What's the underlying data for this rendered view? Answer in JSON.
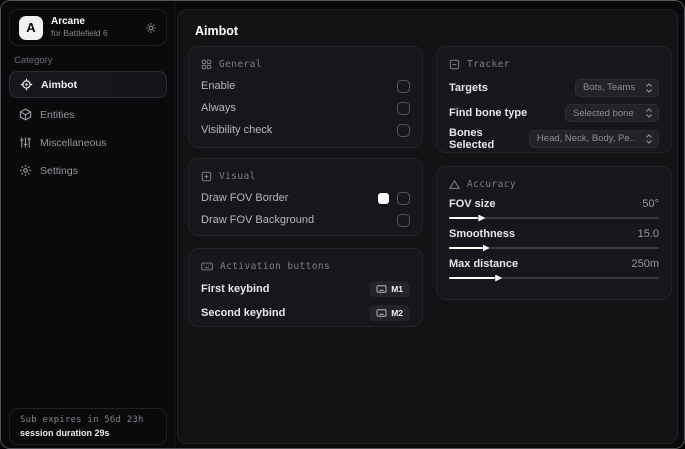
{
  "app": {
    "name": "Arcane",
    "subtitle": "for Battlefield 6",
    "logo_letter": "A"
  },
  "sidebar": {
    "category_label": "Category",
    "items": [
      {
        "label": "Aimbot",
        "icon": "crosshair-icon",
        "active": true
      },
      {
        "label": "Entities",
        "icon": "cube-icon",
        "active": false
      },
      {
        "label": "Miscellaneous",
        "icon": "sliders-icon",
        "active": false
      },
      {
        "label": "Settings",
        "icon": "gear-icon",
        "active": false
      }
    ],
    "subscription": {
      "expires_text": "Sub expires in 56d 23h",
      "session_text": "session duration 29s"
    }
  },
  "main": {
    "title": "Aimbot",
    "general": {
      "title": "General",
      "rows": [
        {
          "label": "Enable",
          "checked": false
        },
        {
          "label": "Always",
          "checked": false
        },
        {
          "label": "Visibility check",
          "checked": false
        }
      ]
    },
    "visual": {
      "title": "Visual",
      "rows": [
        {
          "label": "Draw FOV Border",
          "swatch": "#ffffff",
          "checked": false
        },
        {
          "label": "Draw FOV Background",
          "checked": false
        }
      ]
    },
    "activation": {
      "title": "Activation buttons",
      "rows": [
        {
          "label": "First keybind",
          "key": "M1"
        },
        {
          "label": "Second keybind",
          "key": "M2"
        }
      ]
    },
    "tracker": {
      "title": "Tracker",
      "rows": [
        {
          "label": "Targets",
          "value": "Bots, Teams"
        },
        {
          "label": "Find bone type",
          "value": "Selected bone"
        },
        {
          "label": "Bones Selected",
          "value": "Head, Neck, Body, Pe.."
        }
      ]
    },
    "accuracy": {
      "title": "Accuracy",
      "sliders": [
        {
          "label": "FOV size",
          "value": "50°",
          "fill_pct": 14
        },
        {
          "label": "Smoothness",
          "value": "15.0",
          "fill_pct": 16
        },
        {
          "label": "Max distance",
          "value": "250m",
          "fill_pct": 22
        }
      ]
    }
  },
  "colors": {
    "accent": "#ffffff",
    "fov_border_swatch": "#ffffff",
    "card_bg": "#17171b",
    "panel_bg": "#131316",
    "window_bg": "#0a0a0c"
  }
}
